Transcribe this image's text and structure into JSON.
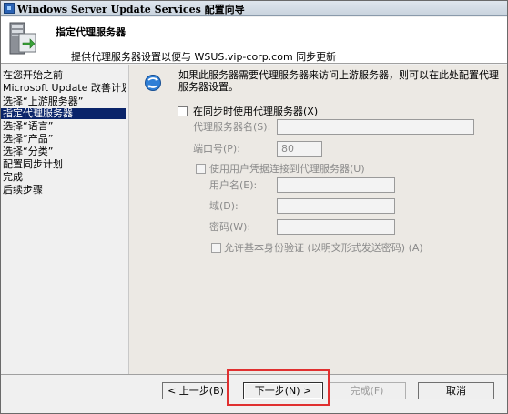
{
  "window": {
    "title": "Windows Server Update Services 配置向导"
  },
  "header": {
    "title": "指定代理服务器",
    "subtitle": "提供代理服务器设置以便与 WSUS.vip-corp.com 同步更新"
  },
  "nav": {
    "items": [
      {
        "label": "在您开始之前",
        "active": false
      },
      {
        "label": "Microsoft Update 改善计划",
        "active": false
      },
      {
        "label": "选择“上游服务器”",
        "active": false
      },
      {
        "label": "指定代理服务器",
        "active": true
      },
      {
        "label": "选择“语言”",
        "active": false
      },
      {
        "label": "选择“产品”",
        "active": false
      },
      {
        "label": "选择“分类”",
        "active": false
      },
      {
        "label": "配置同步计划",
        "active": false
      },
      {
        "label": "完成",
        "active": false
      },
      {
        "label": "后续步骤",
        "active": false
      }
    ]
  },
  "main": {
    "description": "如果此服务器需要代理服务器来访问上游服务器，则可以在此处配置代理服务器设置。",
    "use_proxy_label": "在同步时使用代理服务器(X)",
    "proxy_name_label": "代理服务器名(S):",
    "proxy_name_value": "",
    "port_label": "端口号(P):",
    "port_value": "80",
    "use_credentials_label": "使用用户凭据连接到代理服务器(U)",
    "username_label": "用户名(E):",
    "username_value": "",
    "domain_label": "域(D):",
    "domain_value": "",
    "password_label": "密码(W):",
    "password_value": "",
    "basic_auth_label": "允许基本身份验证 (以明文形式发送密码) (A)"
  },
  "buttons": {
    "back": "< 上一步(B)",
    "next": "下一步(N) >",
    "finish": "完成(F)",
    "cancel": "取消"
  },
  "colors": {
    "nav_active_bg": "#0a246a",
    "highlight": "#e03030"
  },
  "icons": {
    "app": "wsus-app-icon",
    "header": "server-wizard-icon",
    "info": "globe-refresh-icon"
  }
}
